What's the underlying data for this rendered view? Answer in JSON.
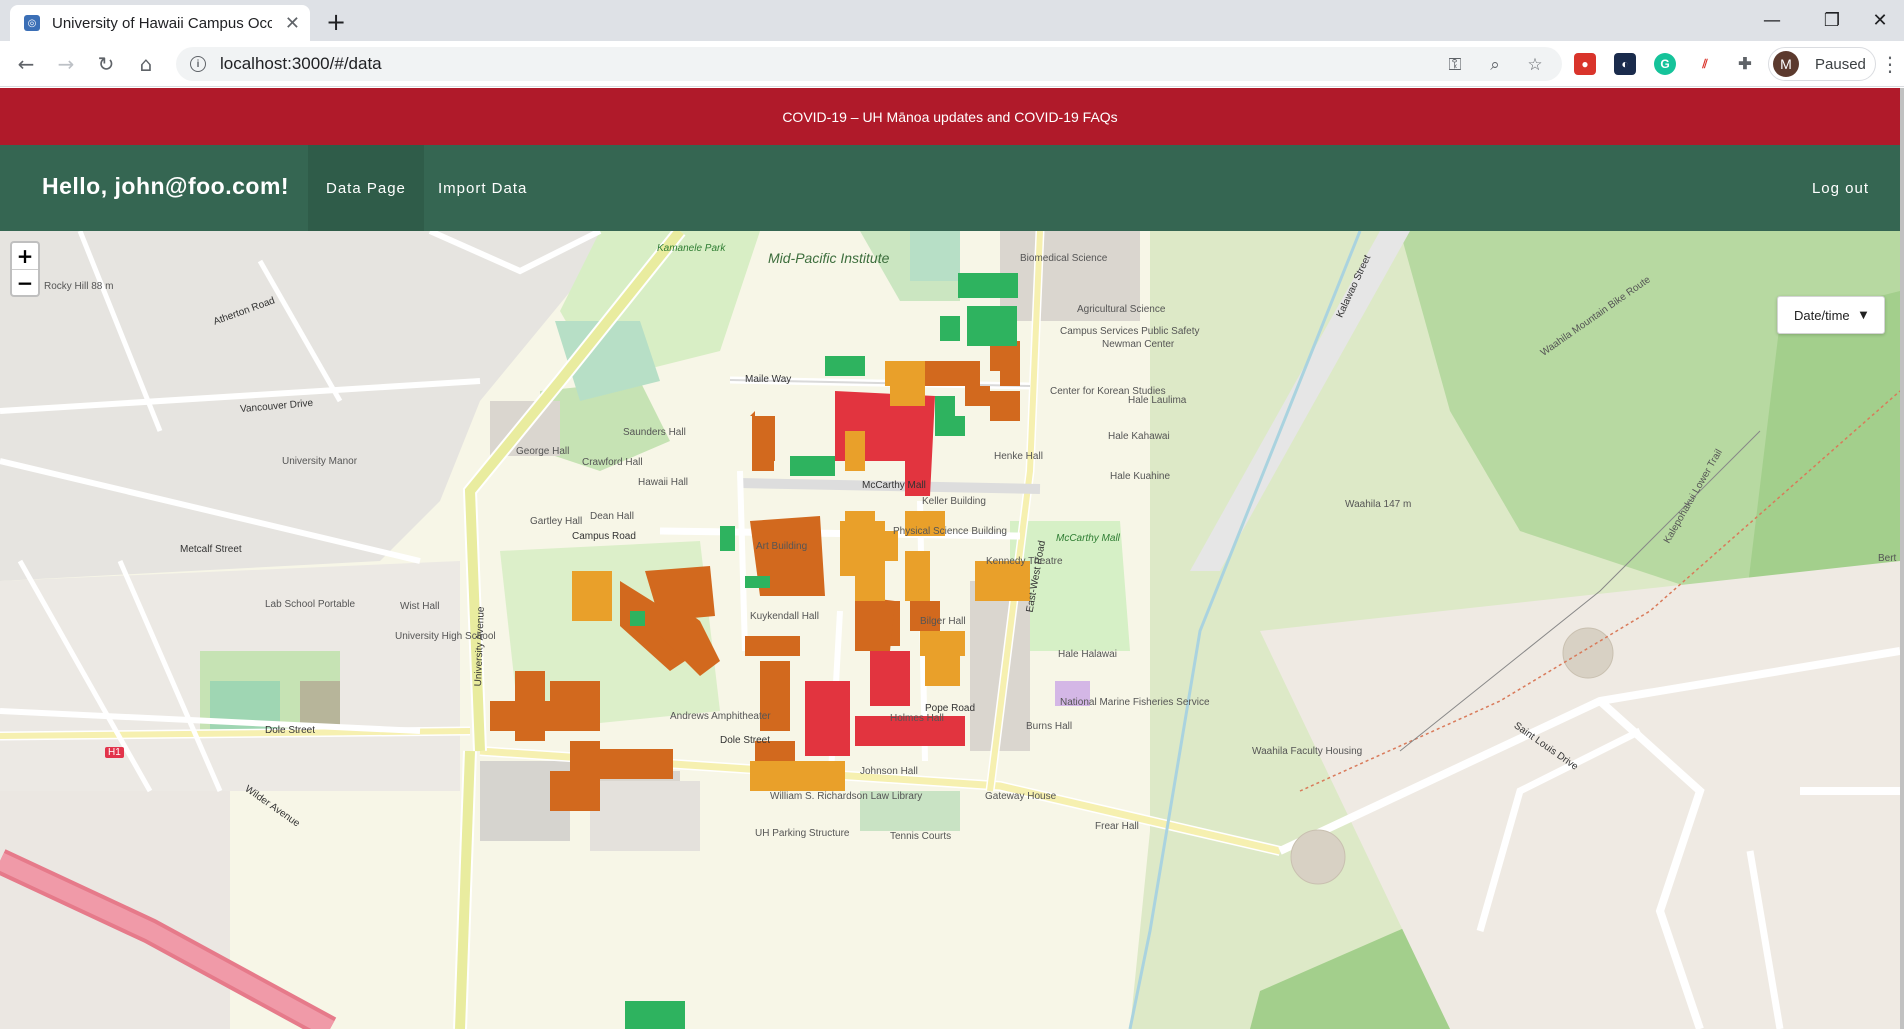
{
  "browser": {
    "tab_title": "University of Hawaii Campus Occ",
    "tab_favicon": "globe-icon",
    "url": "localhost:3000/#/data",
    "profile_initial": "M",
    "profile_label": "Paused"
  },
  "banner": {
    "text": "COVID-19 – UH Mānoa updates and COVID-19 FAQs"
  },
  "navbar": {
    "brand": "Hello, john@foo.com!",
    "items": [
      {
        "label": "Data Page",
        "active": true
      },
      {
        "label": "Import Data",
        "active": false
      }
    ],
    "logout": "Log out"
  },
  "map": {
    "zoom_in": "+",
    "zoom_out": "−",
    "date_dropdown": "Date/time",
    "labels": {
      "mid_pacific": "Mid-Pacific Institute",
      "biomedical": "Biomedical Science",
      "agricultural": "Agricultural Science",
      "campus_services": "Campus Services Public Safety",
      "newman": "Newman Center",
      "korean": "Center for Korean Studies",
      "hale_laulima": "Hale Laulima",
      "hale_kahawai": "Hale Kahawai",
      "hale_kuahine": "Hale Kuahine",
      "henke": "Henke Hall",
      "mccarthy_mall": "McCarthy Mall",
      "mccarthy_mall_green": "McCarthy Mall",
      "maile_way": "Maile Way",
      "campus_road": "Campus Road",
      "dole_street": "Dole Street",
      "dole_street_2": "Dole Street",
      "pope_road": "Pope Road",
      "university_ave": "University Avenue",
      "east_west_road": "East-West Road",
      "george_hall": "George Hall",
      "crawford": "Crawford Hall",
      "saunders": "Saunders Hall",
      "hawaii_hall": "Hawaii Hall",
      "dean_hall": "Dean Hall",
      "gartley": "Gartley Hall",
      "art_building": "Art Building",
      "physical_science": "Physical Science Building",
      "kennedy_theatre": "Kennedy Theatre",
      "holmes": "Holmes Hall",
      "bilger": "Bilger Hall",
      "kuykendall": "Kuykendall Hall",
      "keller": "Keller Building",
      "burns": "Burns Hall",
      "hale_halawai": "Hale Halawai",
      "nmfs": "National Marine Fisheries Service",
      "university_manor": "University Manor",
      "lab_school": "Lab School Portable",
      "wist": "Wist Hall",
      "uh_high": "University High School",
      "andrews": "Andrews Amphitheater",
      "law_library": "William S. Richardson Law Library",
      "johnson_hall": "Johnson Hall",
      "gateway": "Gateway House",
      "frear": "Frear Hall",
      "waahila_housing": "Waahila Faculty Housing",
      "waahila_peak": "Waahila 147 m",
      "kalawao": "Kalawao Street",
      "waahila_bike": "Waahila Mountain Bike Route",
      "kalepohakui": "Kalepohakui Lower Trail",
      "rocky_hill": "Rocky Hill 88 m",
      "vancouver_drive": "Vancouver Drive",
      "metcalf": "Metcalf Street",
      "atherton": "Atherton Road",
      "wilder": "Wilder Avenue",
      "h1": "H1",
      "kamanele": "Kamanele Park",
      "uh_parking": "UH Parking Structure",
      "tennis": "Tennis Courts",
      "bert": "Bert",
      "saint_louis": "Saint Louis Drive"
    }
  },
  "colors": {
    "banner": "#b01a2a",
    "navbar": "#356652",
    "occupancy_high": "#e2343f",
    "occupancy_mid_high": "#d2691e",
    "occupancy_mid": "#e9a02a",
    "occupancy_low": "#2eb35f"
  }
}
